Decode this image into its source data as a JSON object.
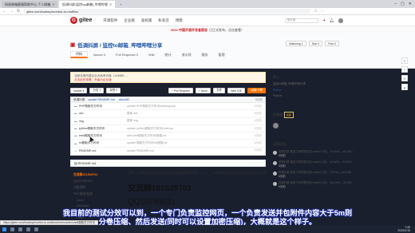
{
  "browser": {
    "tabs": [
      {
        "label": "网易邮箱客服帮助中心-个人邮箱",
        "active": false
      },
      {
        "label": "低调抖屏/监控/qq邮箱_哔哩哔哩",
        "active": true
      }
    ],
    "url": "gitee.com/lowkey/monitor-to-mailbox"
  },
  "gitee": {
    "logo_text": "gitee",
    "nav": [
      "开源软件",
      "企业版",
      "高校版",
      "私有云",
      "博客"
    ],
    "search_placeholder": "搜开源",
    "banner_text": "2022 中国开源开发者报告",
    "banner_suffix": "已正式发布，点击查看！"
  },
  "repo": {
    "title": "低调抖屏 / 监控to邮箱_哔哩哔哩分享",
    "watch_label": "Watching",
    "watch_count": "1",
    "star_label": "Star",
    "star_count": "0",
    "fork_label": "Fork",
    "fork_count": "0",
    "tabs": [
      "代码",
      "Issues",
      "Pull Requests",
      "Wiki",
      "统计",
      "流水线",
      "服务",
      "管理"
    ],
    "tab_counts": [
      "",
      "0",
      "0",
      "",
      "",
      "",
      "",
      ""
    ],
    "notice": "当前仓库所属企业为私有仓库（1x5MB），",
    "notice_link": "点击此处查看，升级为企业版",
    "branch": "master",
    "branches": "分支 1",
    "tags": "标签 0",
    "pr_btn": "+ Pull Request",
    "add_btn": "+ Issue",
    "file_btn": "文件",
    "web_ide": "Web IDE",
    "clone_btn": "克隆/下载",
    "commit_author": "低调抖屏",
    "commit_msg": "update README.md.",
    "commit_hash": "abc1d87",
    "commit_time": "5天前",
    "files": [
      {
        "name": "PHP爬取东方时讯",
        "msg": "update PHP爬取东方时讯/caching.php",
        "time": "6天前"
      },
      {
        "name": "doc",
        "msg": "更新 doc",
        "time": "6天前"
      },
      {
        "name": "img",
        "msg": "更新 img",
        "time": "6天前"
      },
      {
        "name": "python爬取东方时讯",
        "msg": "update python爬取东方时讯/main.py",
        "time": "6天前"
      },
      {
        "name": "shell爬取东方时讯",
        "msg": "add shell爬取东方时讯/新建.txt",
        "time": "6天前"
      },
      {
        "name": "txt爬取东方时讯",
        "msg": "update 爬取东方时讯/txt爬取.txt",
        "time": "6天前"
      },
      {
        "name": "README.md",
        "msg": "update README.md.",
        "time": "5天前"
      }
    ],
    "readme_label": "README.md"
  },
  "sidebar": {
    "intro_h": "简介",
    "intro_t": "监控to邮箱_哔哩哔哩分享",
    "lang_link": "Python",
    "lang": "Python",
    "contrib_h": "贡献者",
    "contrib_more": "全部",
    "activity_h": "近期动态",
    "events": [
      {
        "text": "低调抖屏 推送了新的提交到 master 分支，7e16bc2...abc1d87",
        "time": "5天前"
      },
      {
        "text": "低调抖屏 推送了新的提交到 master 分支，ae3c0fb...7e16bc2",
        "time": "5天前"
      },
      {
        "text": "低调抖屏 推送了新的提交到 master 分支，1f07de1...ae3c0fb",
        "time": "6天前"
      },
      {
        "text": "低调抖屏 推送了新的提交到 master 分支，6a12ee8...1f07de1",
        "time": "6天前"
      }
    ]
  },
  "toc": {
    "items": [
      "交流群161529701",
      "QQ107890311",
      "功能说明",
      "PHP服务/监控",
      "Linux",
      "Windows",
      "python",
      "Linux",
      "Windows"
    ],
    "selected_index": 0
  },
  "readme": {
    "intro": "这是一个把监控手游/网页各项变化邮箱通知的项目（10s，15s邮箱的中分各自动保存在对应的位置）",
    "group": "交流群161529701",
    "qq": "QQ10789031"
  },
  "subtitles": {
    "line1": "我目前的测试分效可以到，一个专门负责监控网页，一个负责发送并包附件内容大于5m则",
    "line2": "分卷压缩、然后发送(同时可以设置加密压缩)，大概就是这个样子。"
  },
  "statusbar": {
    "text": "https://gitee.com/lowkey/monitor-to-mailbox/tree/master/shell爬取东方时讯"
  },
  "taskbar": {
    "time": "7:40",
    "date": "2023/2/16"
  },
  "colors": {
    "brand": "#c71d23",
    "accent": "#fe7300",
    "link": "#1e55a8",
    "subtitle_stroke": "#1c2c9e"
  }
}
